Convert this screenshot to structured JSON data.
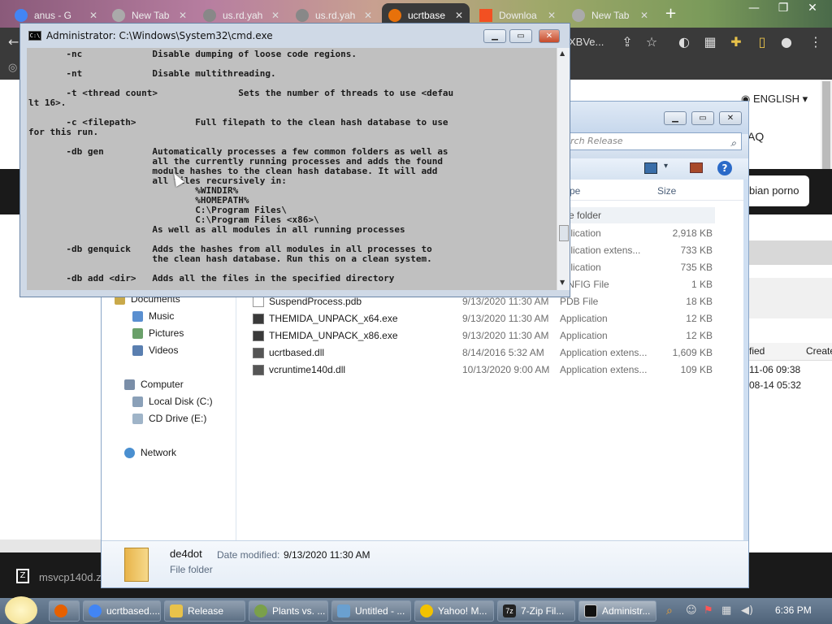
{
  "browser": {
    "tabs": [
      {
        "label": "anus - G",
        "color": "#4285f4"
      },
      {
        "label": "New Tab",
        "color": "#aaaaaa"
      },
      {
        "label": "us.rd.yah",
        "color": "#888888"
      },
      {
        "label": "us.rd.yah",
        "color": "#888888"
      },
      {
        "label": "ucrtbase",
        "color": "#e8710a"
      },
      {
        "label": "Downloa",
        "color": "#f25022"
      },
      {
        "label": "New Tab",
        "color": "#aaaaaa"
      }
    ],
    "omnibox_tail": "XBVe...",
    "language": "ENGLISH",
    "faq": "AQ",
    "search_chip": "bian porno",
    "download_file": "msvcp140d.z"
  },
  "cmd": {
    "title": "Administrator: C:\\Windows\\System32\\cmd.exe",
    "icon_text": "C:\\",
    "lines": [
      "       -nc             Disable dumping of loose code regions.",
      "",
      "       -nt             Disable multithreading.",
      "",
      "       -t <thread count>               Sets the number of threads to use <defau",
      "lt 16>.",
      "",
      "       -c <filepath>           Full filepath to the clean hash database to use",
      "for this run.",
      "",
      "       -db gen         Automatically processes a few common folders as well as",
      "                       all the currently running processes and adds the found",
      "                       module hashes to the clean hash database. It will add",
      "                       all files recursively in:",
      "                               %WINDIR%",
      "                               %HOMEPATH%",
      "                               C:\\Program Files\\",
      "                               C:\\Program Files <x86>\\",
      "                       As well as all modules in all running processes",
      "",
      "       -db genquick    Adds the hashes from all modules in all processes to",
      "                       the clean hash database. Run this on a clean system.",
      "",
      "       -db add <dir>   Adds all the files in the specified directory"
    ]
  },
  "explorer": {
    "search_placeholder": "rch Release",
    "columns": {
      "type": "pe",
      "size": "Size"
    },
    "folder_row_label": "e folder",
    "nav": [
      {
        "label": "Documents",
        "color": "#c9a94a"
      },
      {
        "label": "Music",
        "color": "#5a8fd0"
      },
      {
        "label": "Pictures",
        "color": "#6aa06a"
      },
      {
        "label": "Videos",
        "color": "#5a7fb0"
      },
      {
        "label": "Computer",
        "color": "#7a8ea8"
      },
      {
        "label": "Local Disk (C:)",
        "color": "#8aa0b8"
      },
      {
        "label": "CD Drive (E:)",
        "color": "#9fb4c8"
      },
      {
        "label": "Network",
        "color": "#4a8fd0"
      }
    ],
    "files": [
      {
        "name": "",
        "date": "",
        "type": "pplication",
        "size": "2,918 KB",
        "icon": "exe"
      },
      {
        "name": "",
        "date": "",
        "type": "pplication extens...",
        "size": "733 KB",
        "icon": "dll"
      },
      {
        "name": "",
        "date": "",
        "type": "pplication",
        "size": "735 KB",
        "icon": "exe"
      },
      {
        "name": "",
        "date": "",
        "type": "ONFIG File",
        "size": "1 KB",
        "icon": "pdb"
      },
      {
        "name": "SuspendProcess.pdb",
        "date": "9/13/2020 11:30 AM",
        "type": "PDB File",
        "size": "18 KB",
        "icon": "pdb"
      },
      {
        "name": "THEMIDA_UNPACK_x64.exe",
        "date": "9/13/2020 11:30 AM",
        "type": "Application",
        "size": "12 KB",
        "icon": "exe"
      },
      {
        "name": "THEMIDA_UNPACK_x86.exe",
        "date": "9/13/2020 11:30 AM",
        "type": "Application",
        "size": "12 KB",
        "icon": "exe"
      },
      {
        "name": "ucrtbased.dll",
        "date": "8/14/2016 5:32 AM",
        "type": "Application extens...",
        "size": "1,609 KB",
        "icon": "dll"
      },
      {
        "name": "vcruntime140d.dll",
        "date": "10/13/2020 9:00 AM",
        "type": "Application extens...",
        "size": "109 KB",
        "icon": "dll"
      }
    ],
    "details": {
      "name": "de4dot",
      "modified_label": "Date modified:",
      "modified_value": "9/13/2020 11:30 AM",
      "kind": "File folder"
    }
  },
  "background_page": {
    "header_modified": "fied",
    "header_created": "Create",
    "rows": [
      "11-06 09:38",
      "08-14 05:32"
    ]
  },
  "taskbar": {
    "items": [
      {
        "label": "",
        "color": "#e66000"
      },
      {
        "label": "ucrtbased....",
        "color": "#4285f4"
      },
      {
        "label": "Release",
        "color": "#e8c24a"
      },
      {
        "label": "Plants vs. ...",
        "color": "#7aa04a"
      },
      {
        "label": "Untitled - ...",
        "color": "#6aa0d0"
      },
      {
        "label": "Yahoo! M...",
        "color": "#f2c200"
      },
      {
        "label": "7-Zip Fil...",
        "color": "#222222"
      },
      {
        "label": "Administr...",
        "color": "#111111"
      }
    ],
    "clock": "6:36 PM"
  }
}
